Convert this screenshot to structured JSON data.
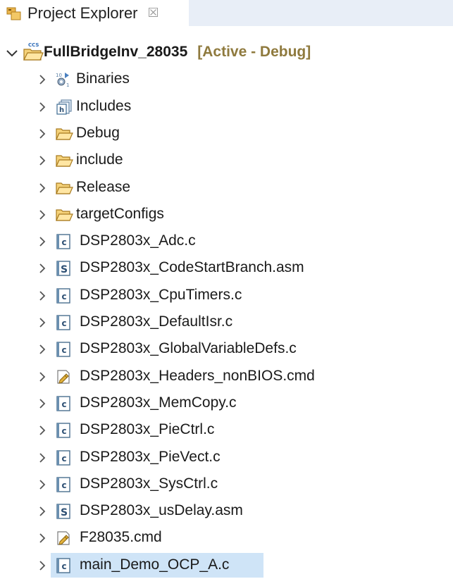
{
  "view": {
    "title": "Project Explorer",
    "close_glyph": "☒"
  },
  "project": {
    "name": "FullBridgeInv_28035",
    "status": "[Active - Debug]",
    "icon": "ccs-project-icon",
    "expanded": true
  },
  "tree": [
    {
      "label": "Binaries",
      "icon": "binaries-icon"
    },
    {
      "label": "Includes",
      "icon": "includes-icon"
    },
    {
      "label": "Debug",
      "icon": "folder-icon"
    },
    {
      "label": "include",
      "icon": "folder-icon"
    },
    {
      "label": "Release",
      "icon": "folder-icon"
    },
    {
      "label": "targetConfigs",
      "icon": "folder-icon"
    },
    {
      "label": "DSP2803x_Adc.c",
      "icon": "c-file-icon"
    },
    {
      "label": "DSP2803x_CodeStartBranch.asm",
      "icon": "asm-file-icon"
    },
    {
      "label": "DSP2803x_CpuTimers.c",
      "icon": "c-file-icon"
    },
    {
      "label": "DSP2803x_DefaultIsr.c",
      "icon": "c-file-icon"
    },
    {
      "label": "DSP2803x_GlobalVariableDefs.c",
      "icon": "c-file-icon"
    },
    {
      "label": "DSP2803x_Headers_nonBIOS.cmd",
      "icon": "cmd-file-icon"
    },
    {
      "label": "DSP2803x_MemCopy.c",
      "icon": "c-file-icon"
    },
    {
      "label": "DSP2803x_PieCtrl.c",
      "icon": "c-file-icon"
    },
    {
      "label": "DSP2803x_PieVect.c",
      "icon": "c-file-icon"
    },
    {
      "label": "DSP2803x_SysCtrl.c",
      "icon": "c-file-icon"
    },
    {
      "label": "DSP2803x_usDelay.asm",
      "icon": "asm-file-icon"
    },
    {
      "label": "F28035.cmd",
      "icon": "cmd-file-icon"
    },
    {
      "label": "main_Demo_OCP_A.c",
      "icon": "c-file-icon",
      "selected": true
    }
  ],
  "colors": {
    "selection": "#cfe4f7",
    "status": "#8f7a3e",
    "inactive_tab_strip": "#e8eef7"
  }
}
